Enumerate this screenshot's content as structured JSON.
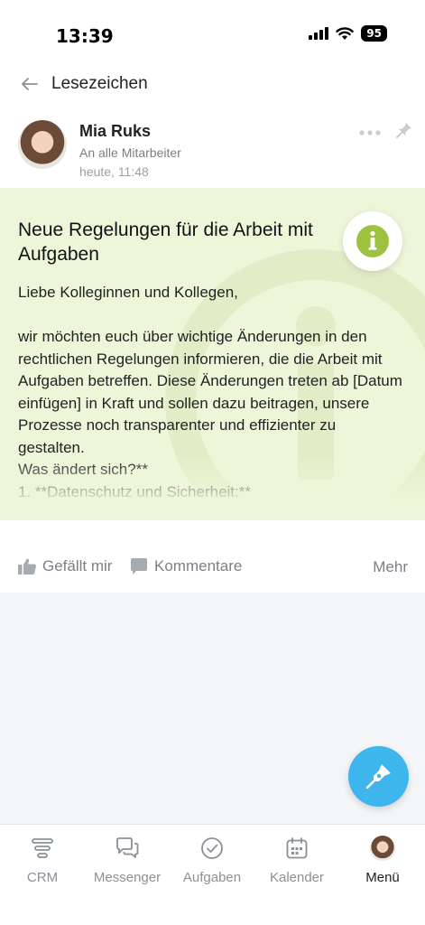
{
  "status_bar": {
    "time": "13:39",
    "battery": "95"
  },
  "header": {
    "title": "Lesezeichen"
  },
  "post": {
    "author_name": "Mia Ruks",
    "audience": "An alle Mitarbeiter",
    "time": "heute, 11:48",
    "title": "Neue Regelungen für die Arbeit mit Aufgaben",
    "body": "Liebe Kolleginnen und Kollegen,\n\nwir möchten euch über wichtige Änderungen in den rechtlichen Regelungen informieren, die die Arbeit mit Aufgaben betreffen. Diese Änderungen treten ab [Datum einfügen] in Kraft und sollen dazu beitragen, unsere Prozesse noch transparenter und effizienter zu gestalten.\nWas ändert sich?**\n1. **Datenschutz und Sicherheit:**\nAlle Aufgaben müssen ab sofort den neuen",
    "actions": {
      "like": "Gefällt mir",
      "comments": "Kommentare",
      "more": "Mehr"
    }
  },
  "tabbar": {
    "items": [
      {
        "label": "CRM",
        "icon": "crm-icon"
      },
      {
        "label": "Messenger",
        "icon": "messenger-icon"
      },
      {
        "label": "Aufgaben",
        "icon": "tasks-icon"
      },
      {
        "label": "Kalender",
        "icon": "calendar-icon"
      },
      {
        "label": "Menü",
        "icon": "avatar"
      }
    ]
  },
  "colors": {
    "accent_blue": "#3fb5ed",
    "info_green": "#9dc23f",
    "card_background": "#eef6da"
  }
}
